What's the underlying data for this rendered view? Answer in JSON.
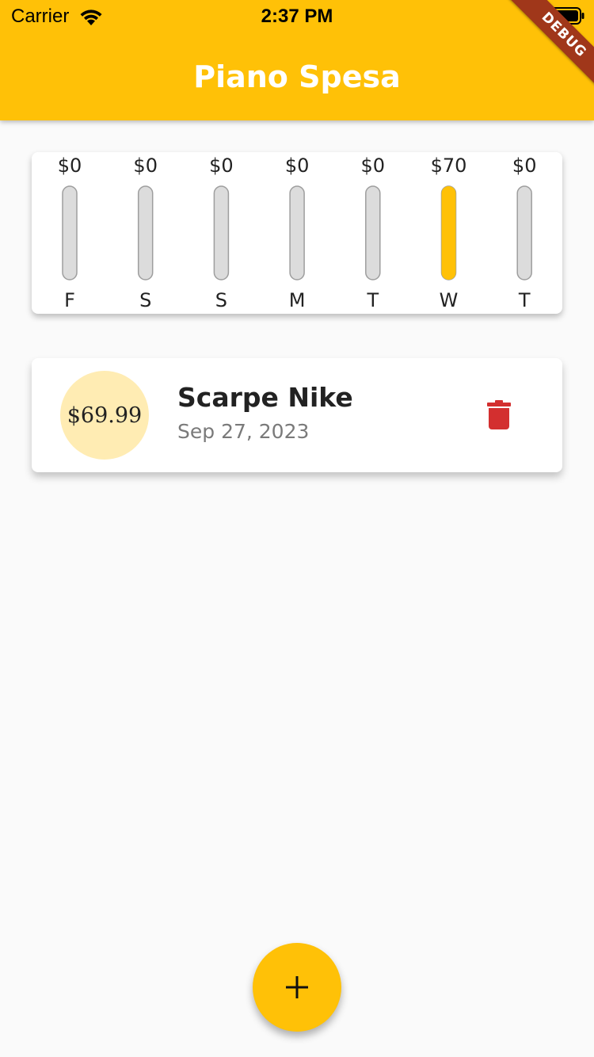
{
  "status_bar": {
    "carrier": "Carrier",
    "time": "2:37 PM"
  },
  "app_bar": {
    "title": "Piano Spesa",
    "color": "#ffc107",
    "debug_label": "DEBUG"
  },
  "chart_data": {
    "type": "bar",
    "categories": [
      "F",
      "S",
      "S",
      "M",
      "T",
      "W",
      "T"
    ],
    "amount_labels": [
      "$0",
      "$0",
      "$0",
      "$0",
      "$0",
      "$70",
      "$0"
    ],
    "values": [
      0,
      0,
      0,
      0,
      0,
      69.99,
      0
    ],
    "fill_fraction": [
      0,
      0,
      0,
      0,
      0,
      1,
      0
    ],
    "bar_color": "#ffc107",
    "track_color": "#dcdcdc"
  },
  "transactions": [
    {
      "amount": "$69.99",
      "title": "Scarpe Nike",
      "date": "Sep 27, 2023",
      "delete_icon": "trash-icon",
      "delete_color": "#d32f2f"
    }
  ],
  "fab": {
    "icon": "plus-icon",
    "color": "#ffc107"
  }
}
